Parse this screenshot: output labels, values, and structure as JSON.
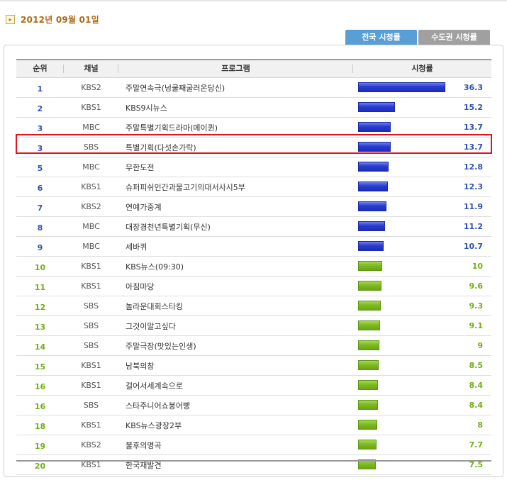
{
  "date": "2012년 09월 01일",
  "tabs": [
    {
      "label": "전국 시청률",
      "active": true
    },
    {
      "label": "수도권 시청률",
      "active": false
    }
  ],
  "table": {
    "headers": {
      "rank": "순위",
      "channel": "채널",
      "program": "프로그램",
      "rating": "시청률"
    },
    "rows": [
      {
        "rank": "1",
        "channel": "KBS2",
        "program": "주말연속극(넝쿨째굴러온당신)",
        "rating": "36.3",
        "rating_value": 36.3
      },
      {
        "rank": "2",
        "channel": "KBS1",
        "program": "KBS9시뉴스",
        "rating": "15.2",
        "rating_value": 15.2
      },
      {
        "rank": "3",
        "channel": "MBC",
        "program": "주말특별기획드라마(메이퀸)",
        "rating": "13.7",
        "rating_value": 13.7
      },
      {
        "rank": "3",
        "channel": "SBS",
        "program": "특별기획(다섯손가락)",
        "rating": "13.7",
        "rating_value": 13.7
      },
      {
        "rank": "5",
        "channel": "MBC",
        "program": "무한도전",
        "rating": "12.8",
        "rating_value": 12.8
      },
      {
        "rank": "6",
        "channel": "KBS1",
        "program": "슈퍼피쉬인간과물고기의대서사시5부",
        "rating": "12.3",
        "rating_value": 12.3
      },
      {
        "rank": "7",
        "channel": "KBS2",
        "program": "연예가중계",
        "rating": "11.9",
        "rating_value": 11.9
      },
      {
        "rank": "8",
        "channel": "MBC",
        "program": "대장경천년특별기획(무신)",
        "rating": "11.2",
        "rating_value": 11.2
      },
      {
        "rank": "9",
        "channel": "MBC",
        "program": "세바퀴",
        "rating": "10.7",
        "rating_value": 10.7
      },
      {
        "rank": "10",
        "channel": "KBS1",
        "program": "KBS뉴스(09:30)",
        "rating": "10",
        "rating_value": 10
      },
      {
        "rank": "11",
        "channel": "KBS1",
        "program": "아침마당",
        "rating": "9.6",
        "rating_value": 9.6
      },
      {
        "rank": "12",
        "channel": "SBS",
        "program": "놀라운대회스타킹",
        "rating": "9.3",
        "rating_value": 9.3
      },
      {
        "rank": "13",
        "channel": "SBS",
        "program": "그것이알고싶다",
        "rating": "9.1",
        "rating_value": 9.1
      },
      {
        "rank": "14",
        "channel": "SBS",
        "program": "주말극장(맛있는인생)",
        "rating": "9",
        "rating_value": 9
      },
      {
        "rank": "15",
        "channel": "KBS1",
        "program": "남북의창",
        "rating": "8.5",
        "rating_value": 8.5
      },
      {
        "rank": "16",
        "channel": "KBS1",
        "program": "걸어서세계속으로",
        "rating": "8.4",
        "rating_value": 8.4
      },
      {
        "rank": "16",
        "channel": "SBS",
        "program": "스타주니어쇼붕어빵",
        "rating": "8.4",
        "rating_value": 8.4
      },
      {
        "rank": "18",
        "channel": "KBS1",
        "program": "KBS뉴스광장2부",
        "rating": "8",
        "rating_value": 8
      },
      {
        "rank": "19",
        "channel": "KBS2",
        "program": "불후의명곡",
        "rating": "7.7",
        "rating_value": 7.7
      },
      {
        "rank": "20",
        "channel": "KBS1",
        "program": "한국재발견",
        "rating": "7.5",
        "rating_value": 7.5
      }
    ]
  },
  "highlighted_row_index": 3,
  "colors": {
    "top_rank": "#2f53b0",
    "lower_rank": "#72ae17",
    "highlight": "#e0141c",
    "date": "#b06a14"
  },
  "icons": {
    "date": "arrow-right-box-icon"
  }
}
